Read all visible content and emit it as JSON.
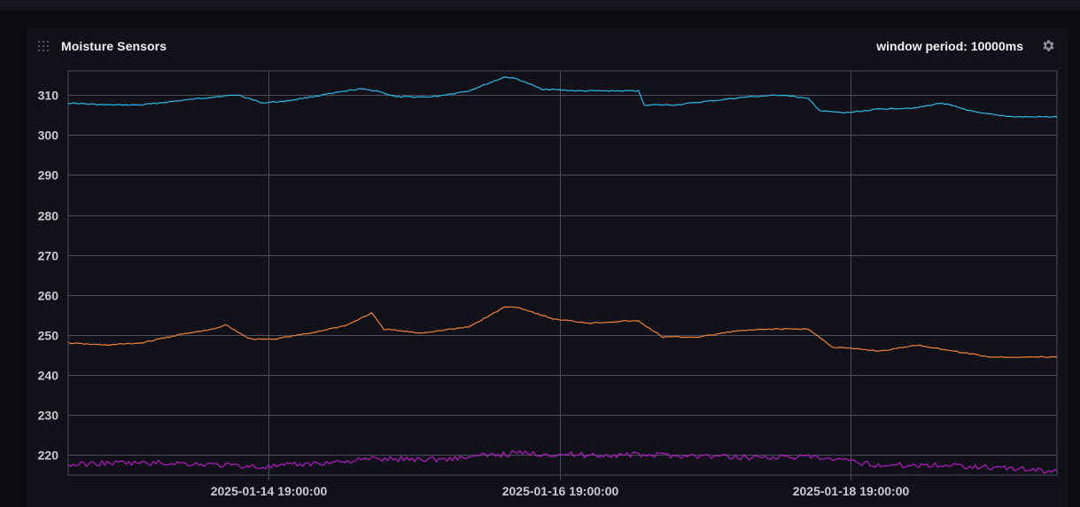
{
  "panel": {
    "title": "Moisture Sensors",
    "window_period_label": "window period: 10000ms"
  },
  "icons": {
    "drag": "drag-handle-icon",
    "settings": "gear-icon"
  },
  "colors": {
    "background": "#0b0c11",
    "panel": "#111219",
    "grid": "#4a4d5c",
    "series": [
      "#2eb9ea",
      "#f3823a",
      "#b519c4"
    ]
  },
  "chart_data": {
    "type": "line",
    "title": "Moisture Sensors",
    "xlabel": "",
    "ylabel": "",
    "grid": true,
    "xlim": [
      "2025-01-13 10:00:00",
      "2025-01-20 05:00:00"
    ],
    "ylim": [
      215,
      316
    ],
    "yticks": [
      220,
      230,
      240,
      250,
      260,
      270,
      280,
      290,
      300,
      310
    ],
    "xticks": [
      "2025-01-14 19:00:00",
      "2025-01-16 19:00:00",
      "2025-01-18 19:00:00"
    ],
    "series": [
      {
        "x": [
          "2025-01-13 10:00:00",
          "2025-01-13 16:00:00",
          "2025-01-13 22:00:00",
          "2025-01-14 04:00:00",
          "2025-01-14 10:00:00",
          "2025-01-14 14:00:00",
          "2025-01-14 18:00:00",
          "2025-01-14 22:00:00",
          "2025-01-15 04:00:00",
          "2025-01-15 10:00:00",
          "2025-01-15 13:00:00",
          "2025-01-15 16:00:00",
          "2025-01-15 22:00:00",
          "2025-01-16 04:00:00",
          "2025-01-16 10:00:00",
          "2025-01-16 12:00:00",
          "2025-01-16 16:00:00",
          "2025-01-16 22:00:00",
          "2025-01-17 04:00:00",
          "2025-01-17 08:00:00",
          "2025-01-17 09:00:00",
          "2025-01-17 14:00:00",
          "2025-01-17 20:00:00",
          "2025-01-18 02:00:00",
          "2025-01-18 08:00:00",
          "2025-01-18 12:00:00",
          "2025-01-18 14:00:00",
          "2025-01-18 18:00:00",
          "2025-01-19 00:00:00",
          "2025-01-19 06:00:00",
          "2025-01-19 10:00:00",
          "2025-01-19 16:00:00",
          "2025-01-19 22:00:00",
          "2025-01-20 05:00:00"
        ],
        "values": [
          308.0,
          307.5,
          307.5,
          308.5,
          309.5,
          310.0,
          308.0,
          308.5,
          310.0,
          311.5,
          311.0,
          309.5,
          309.5,
          311.0,
          314.5,
          314.0,
          311.5,
          311.0,
          311.0,
          311.0,
          307.5,
          307.5,
          308.5,
          309.5,
          310.0,
          309.0,
          306.0,
          305.5,
          306.5,
          306.8,
          308.0,
          305.5,
          304.5,
          304.5
        ]
      },
      {
        "x": [
          "2025-01-13 10:00:00",
          "2025-01-13 16:00:00",
          "2025-01-13 22:00:00",
          "2025-01-14 04:00:00",
          "2025-01-14 10:00:00",
          "2025-01-14 12:00:00",
          "2025-01-14 16:00:00",
          "2025-01-14 20:00:00",
          "2025-01-15 02:00:00",
          "2025-01-15 08:00:00",
          "2025-01-15 12:00:00",
          "2025-01-15 14:00:00",
          "2025-01-15 20:00:00",
          "2025-01-16 04:00:00",
          "2025-01-16 10:00:00",
          "2025-01-16 12:00:00",
          "2025-01-16 18:00:00",
          "2025-01-17 00:00:00",
          "2025-01-17 06:00:00",
          "2025-01-17 08:00:00",
          "2025-01-17 12:00:00",
          "2025-01-17 18:00:00",
          "2025-01-18 00:00:00",
          "2025-01-18 06:00:00",
          "2025-01-18 12:00:00",
          "2025-01-18 16:00:00",
          "2025-01-19 00:00:00",
          "2025-01-19 06:00:00",
          "2025-01-19 12:00:00",
          "2025-01-19 18:00:00",
          "2025-01-20 05:00:00"
        ],
        "values": [
          248.0,
          247.5,
          248.0,
          250.0,
          251.5,
          252.5,
          249.0,
          249.0,
          250.5,
          252.5,
          255.5,
          251.5,
          250.5,
          252.0,
          257.0,
          257.0,
          254.0,
          253.0,
          253.5,
          253.5,
          249.5,
          249.5,
          251.0,
          251.5,
          251.5,
          247.0,
          246.0,
          247.5,
          246.0,
          244.5,
          244.5
        ]
      },
      {
        "x": [
          "2025-01-13 10:00:00",
          "2025-01-13 16:00:00",
          "2025-01-14 04:00:00",
          "2025-01-14 19:00:00",
          "2025-01-15 12:00:00",
          "2025-01-16 00:00:00",
          "2025-01-16 12:00:00",
          "2025-01-17 00:00:00",
          "2025-01-17 12:00:00",
          "2025-01-18 00:00:00",
          "2025-01-18 12:00:00",
          "2025-01-19 00:00:00",
          "2025-01-19 12:00:00",
          "2025-01-20 05:00:00"
        ],
        "values": [
          217.5,
          218.0,
          218.0,
          217.0,
          219.0,
          219.0,
          220.5,
          220.0,
          220.0,
          219.5,
          219.5,
          217.5,
          217.5,
          216.0
        ]
      }
    ]
  }
}
